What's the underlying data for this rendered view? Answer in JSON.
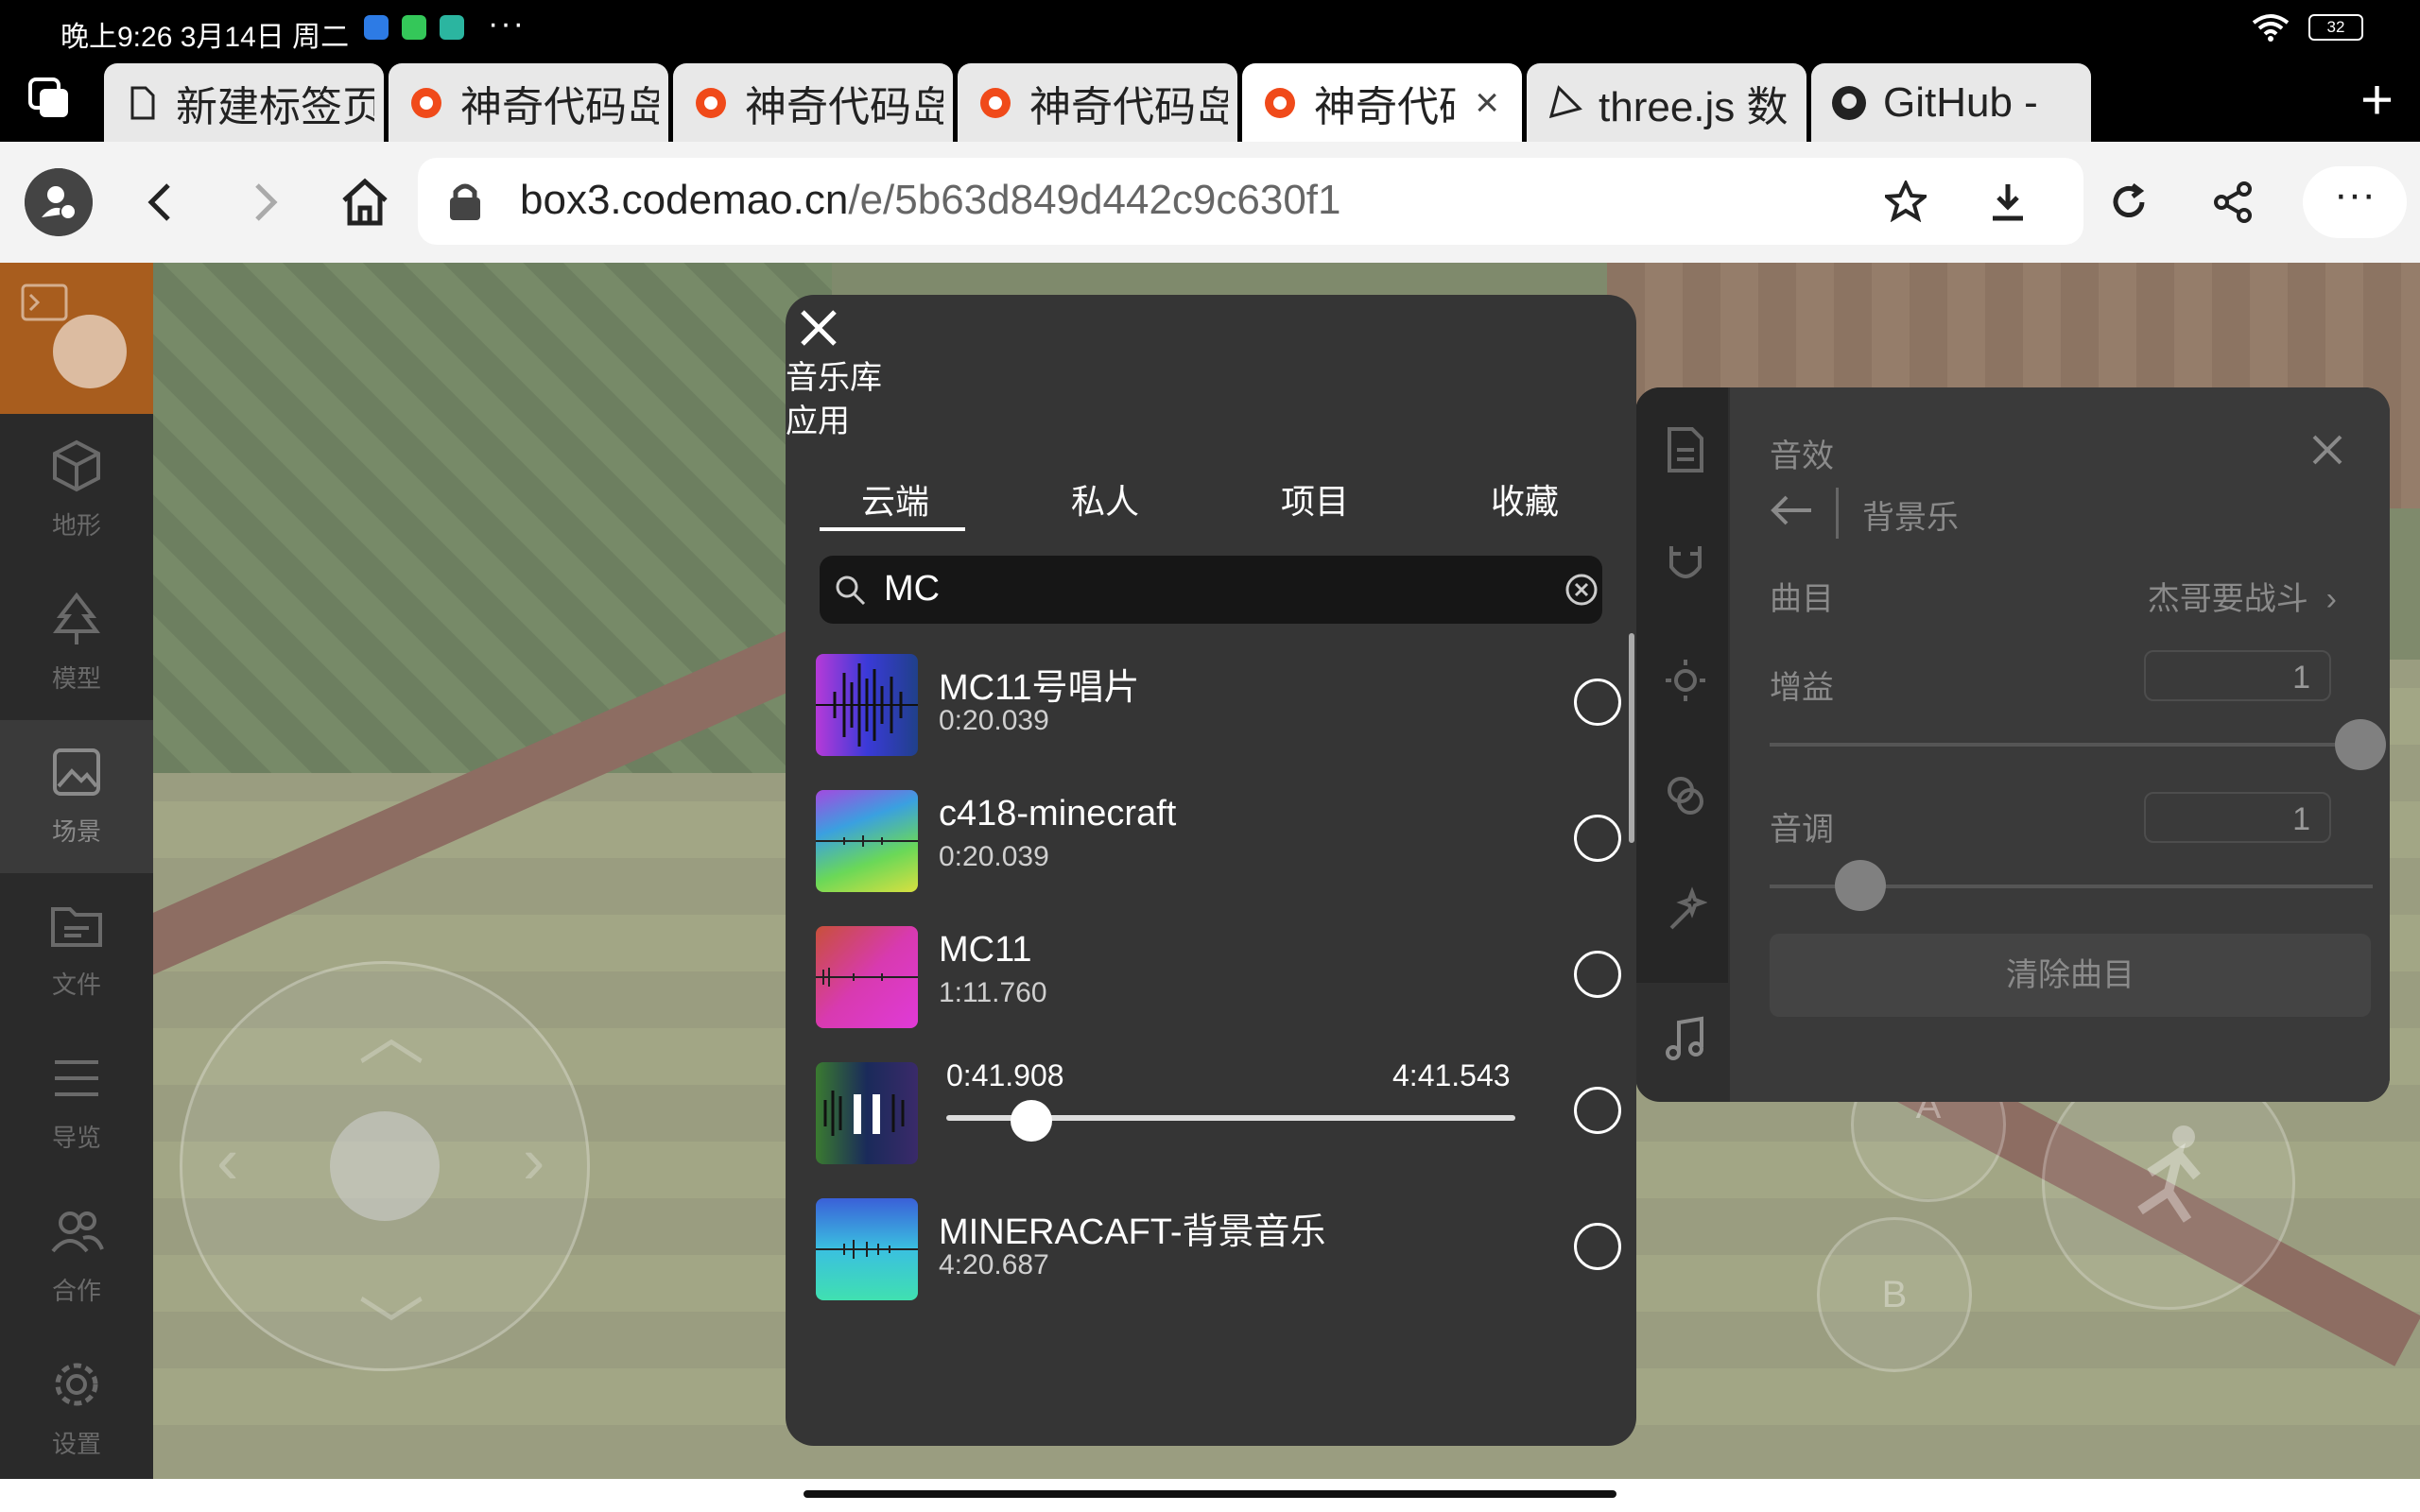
{
  "status_bar": {
    "time": "晚上9:26 3月14日 周二",
    "more": "···",
    "battery": "32",
    "colors": [
      "#2d7be5",
      "#34c759",
      "#2bb5a0"
    ]
  },
  "tabs": [
    {
      "label": "新建标签页",
      "icon": "page-icon"
    },
    {
      "label": "神奇代码岛",
      "icon": "codemao-icon"
    },
    {
      "label": "神奇代码岛",
      "icon": "codemao-icon"
    },
    {
      "label": "神奇代码岛",
      "icon": "codemao-icon"
    },
    {
      "label": "神奇代码岛",
      "icon": "codemao-icon",
      "active": true,
      "close": "×"
    },
    {
      "label": "three.js 数",
      "icon": "threejs-icon"
    },
    {
      "label": "GitHub - ",
      "icon": "github-icon"
    }
  ],
  "new_tab": "+",
  "address_bar": {
    "url_host": "box3.codemao.cn",
    "url_path": "/e/5b63d849d442c9c630f1",
    "menu": "···"
  },
  "sidebar": {
    "items": [
      {
        "label": "地形",
        "icon": "cube-icon"
      },
      {
        "label": "模型",
        "icon": "tree-icon"
      },
      {
        "label": "场景",
        "icon": "image-icon",
        "selected": true
      },
      {
        "label": "文件",
        "icon": "folder-icon"
      },
      {
        "label": "导览",
        "icon": "list-icon"
      },
      {
        "label": "合作",
        "icon": "users-icon"
      },
      {
        "label": "设置",
        "icon": "gear-icon"
      }
    ]
  },
  "game_buttons": {
    "a": "A",
    "b": "B"
  },
  "sfx_panel": {
    "title": "音效",
    "subtitle": "背景乐",
    "track_label": "曲目",
    "track_value": "杰哥要战斗",
    "gain_label": "增益",
    "gain_value": "1",
    "pitch_label": "音调",
    "pitch_value": "1",
    "clear_label": "清除曲目",
    "gain_slider_fraction": 0.98,
    "pitch_slider_fraction": 0.15
  },
  "music_library": {
    "title_line1": "音乐库",
    "title_line2": "应用",
    "tabs": [
      "云端",
      "私人",
      "项目",
      "收藏"
    ],
    "active_tab": 0,
    "search_value": "MC",
    "items": [
      {
        "name": "MC11号唱片",
        "duration": "0:20.039"
      },
      {
        "name": "c418-minecraft",
        "duration": "0:20.039"
      },
      {
        "name": "MC11",
        "duration": "1:11.760"
      },
      {
        "playing": true,
        "current": "0:41.908",
        "total": "4:41.543",
        "progress": 0.149
      },
      {
        "name": "MINERACAFT-背景音乐",
        "duration": "4:20.687"
      }
    ]
  }
}
